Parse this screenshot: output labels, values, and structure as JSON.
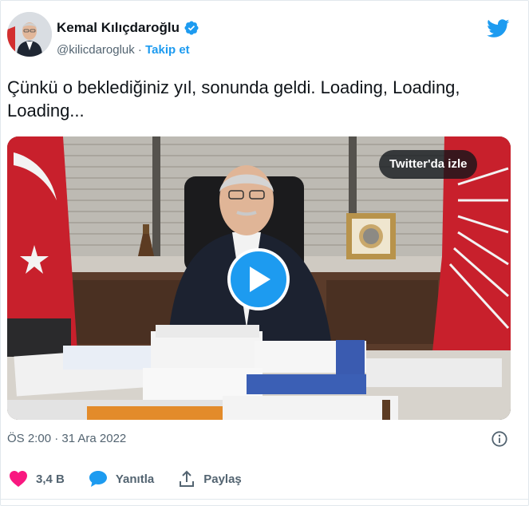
{
  "tweet": {
    "author": {
      "name": "Kemal Kılıçdaroğlu",
      "handle": "@kilicdarogluk",
      "separator": " · ",
      "follow_label": "Takip et",
      "verified": true
    },
    "text": "Çünkü o beklediğiniz yıl, sonunda geldi. Loading, Loading, Loading...",
    "media": {
      "watch_label": "Twitter'da izle",
      "type": "video"
    },
    "timestamp": "ÖS 2:00 · 31 Ara 2022",
    "actions": {
      "like_count": "3,4 B",
      "reply_label": "Yanıtla",
      "share_label": "Paylaş"
    }
  },
  "icons": {
    "platform": "bird-logo-icon",
    "verified": "verified-badge-icon",
    "info": "info-icon",
    "like": "heart-icon",
    "reply": "speech-bubble-icon",
    "share": "share-upload-icon",
    "play": "play-icon"
  },
  "colors": {
    "accent": "#1d9bf0",
    "like": "#f91880",
    "text_primary": "#0f1419",
    "text_secondary": "#536471",
    "border": "#e1e8ed"
  }
}
